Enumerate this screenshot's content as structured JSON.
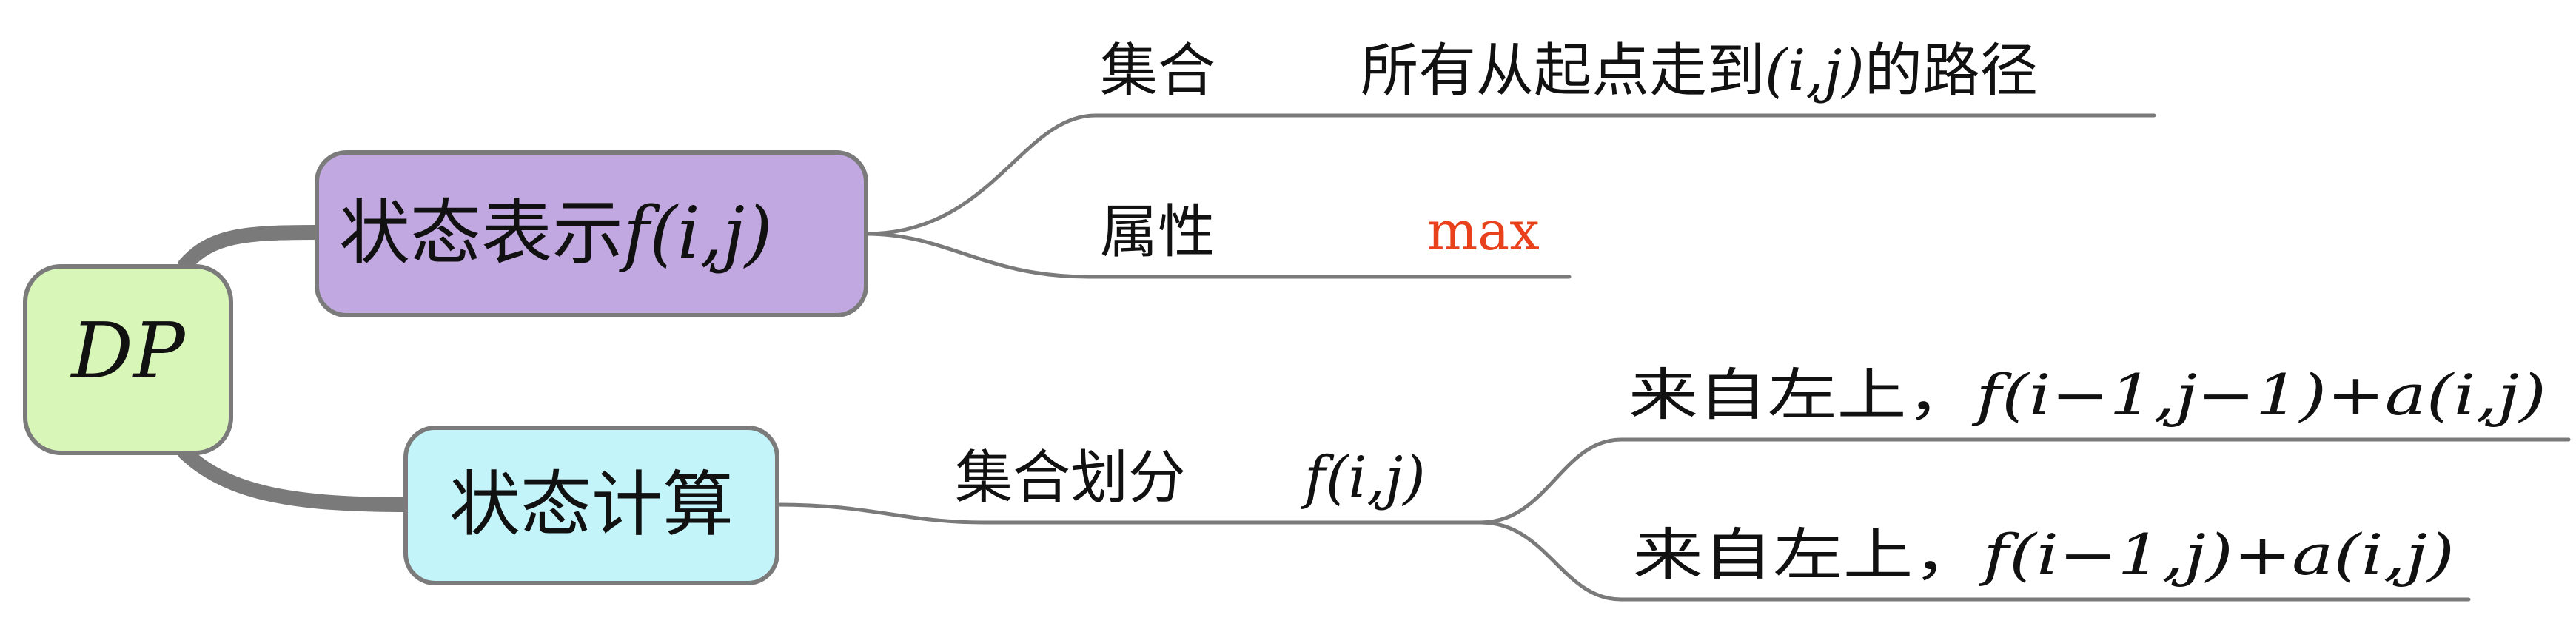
{
  "root": {
    "italic_label": "DP"
  },
  "nodes": {
    "state_repr": {
      "label": "状态表示",
      "formula": "f(i,j)"
    },
    "state_calc": {
      "label": "状态计算"
    }
  },
  "leaves": {
    "set": {
      "label": "集合",
      "value": "所有从起点走到",
      "formula": "(i,j)",
      "suffix": "的路径"
    },
    "attr": {
      "label": "属性",
      "value": "max"
    },
    "partition": {
      "label": "集合划分",
      "formula": "f(i,j)"
    },
    "from_upper_left": {
      "label": "来自左上，",
      "formula": "f(i−1,j−1)+a(i,j)"
    },
    "from_upper_left_2": {
      "label": "来自左上，",
      "formula": "f(i−1,j)+a(i,j)"
    }
  },
  "colors": {
    "root_fill": "#d8f6b8",
    "state_repr_fill": "#c2a8e0",
    "state_calc_fill": "#c2f4f9",
    "connector": "#7a7a7a",
    "highlight": "#e8411c"
  }
}
